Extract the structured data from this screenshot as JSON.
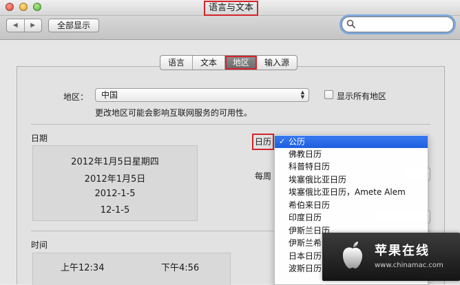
{
  "window": {
    "title": "语言与文本"
  },
  "toolbar": {
    "show_all": "全部显示",
    "nav_back": "◀",
    "nav_forward": "▶",
    "search_placeholder": ""
  },
  "tabs": [
    {
      "label": "语言",
      "active": false
    },
    {
      "label": "文本",
      "active": false
    },
    {
      "label": "地区",
      "active": true
    },
    {
      "label": "输入源",
      "active": false
    }
  ],
  "region": {
    "label": "地区：",
    "value": "中国",
    "show_all_label": "显示所有地区",
    "show_all_checked": false,
    "note": "更改地区可能会影响互联网服务的可用性。"
  },
  "dates": {
    "heading": "日期",
    "samples": [
      "2012年1月5日星期四",
      "2012年1月5日",
      "2012-1-5",
      "12-1-5"
    ],
    "week_label_partial": "每周"
  },
  "calendar": {
    "label": "日历",
    "selected": "公历",
    "options": [
      "公历",
      "佛教日历",
      "科普特日历",
      "埃塞俄比亚日历",
      "埃塞俄比亚日历，Amete Alem",
      "希伯来日历",
      "印度日历",
      "伊斯兰日历",
      "伊斯兰希",
      "日本日历",
      "波斯日历"
    ]
  },
  "time": {
    "heading": "时间",
    "samples": [
      "上午12:34",
      "下午4:56"
    ]
  },
  "watermark": {
    "name": "苹果在线",
    "url": "www.chinamac.com"
  },
  "colors": {
    "highlight_red": "#d2232a",
    "menu_selection": "#1d5ee0",
    "search_focus": "#7fa9db"
  }
}
